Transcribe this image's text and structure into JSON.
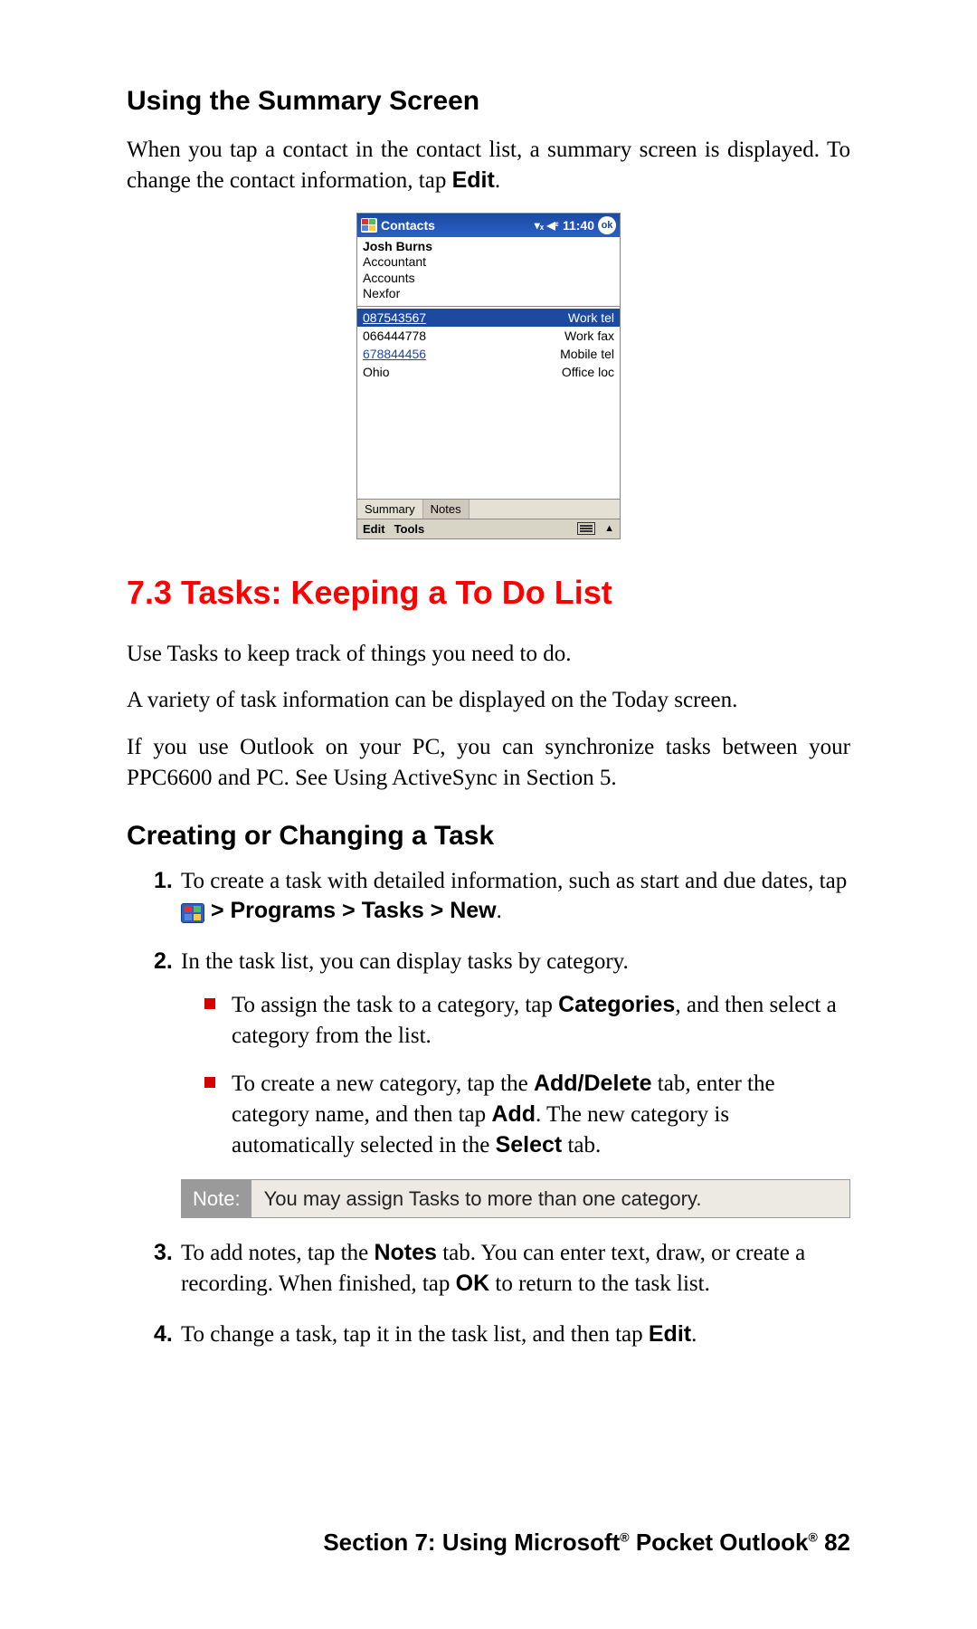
{
  "headings": {
    "summary": "Using the Summary Screen",
    "tasks": "7.3 Tasks: Keeping a To Do List",
    "creating": "Creating or Changing a Task"
  },
  "summary_para_parts": {
    "a": "When you tap a contact in the contact list, a summary screen is displayed. To change the contact information, tap ",
    "b": "Edit",
    "c": "."
  },
  "device": {
    "title": "Contacts",
    "time": "11:40",
    "ok": "ok",
    "name": "Josh Burns",
    "role": "Accountant",
    "dept": "Accounts",
    "company": "Nexfor",
    "rows": [
      {
        "value": "087543567",
        "label": "Work tel",
        "link": true,
        "selected": true
      },
      {
        "value": "066444778",
        "label": "Work fax",
        "link": false,
        "selected": false
      },
      {
        "value": "678844456",
        "label": "Mobile tel",
        "link": true,
        "selected": false
      },
      {
        "value": "Ohio",
        "label": "Office loc",
        "link": false,
        "selected": false
      }
    ],
    "tabs": {
      "active": "Summary",
      "inactive": "Notes"
    },
    "menu": {
      "edit": "Edit",
      "tools": "Tools"
    }
  },
  "tasks_paras": {
    "p1": "Use Tasks to keep track of things you need to do.",
    "p2": "A variety of task information can be displayed on the Today screen.",
    "p3": "If you use Outlook on your PC, you can synchronize tasks between your PPC6600 and PC.  See Using ActiveSync in Section 5."
  },
  "steps": {
    "s1": {
      "num": "1.",
      "a": "To create a task with detailed information, such as start and due dates, tap ",
      "path": " > Programs > Tasks > New",
      "end": "."
    },
    "s2": {
      "num": "2.",
      "text": "In the task list, you can display tasks by category."
    },
    "bullet1": {
      "a": "To assign the task to a category, tap ",
      "b": "Categories",
      "c": ", and then select a category from the list."
    },
    "bullet2": {
      "a": "To create a new category, tap the ",
      "b": "Add/Delete",
      "c": " tab, enter the category name, and then tap ",
      "d": "Add",
      "e": ". The new category is automatically selected in the ",
      "f": "Select",
      "g": " tab."
    },
    "s3": {
      "num": "3.",
      "a": "To add notes, tap the ",
      "b": "Notes",
      "c": " tab. You can enter text, draw, or create a recording. When finished, tap ",
      "d": "OK",
      "e": " to return to the task list."
    },
    "s4": {
      "num": "4.",
      "a": "To change a task, tap it in the task list, and then tap ",
      "b": "Edit",
      "c": "."
    }
  },
  "note": {
    "label": "Note:",
    "text": "You may assign Tasks to more than one category."
  },
  "footer": {
    "a": "Section 7: Using Microsoft",
    "b": " Pocket Outlook",
    "page": " 82",
    "reg": "®"
  }
}
